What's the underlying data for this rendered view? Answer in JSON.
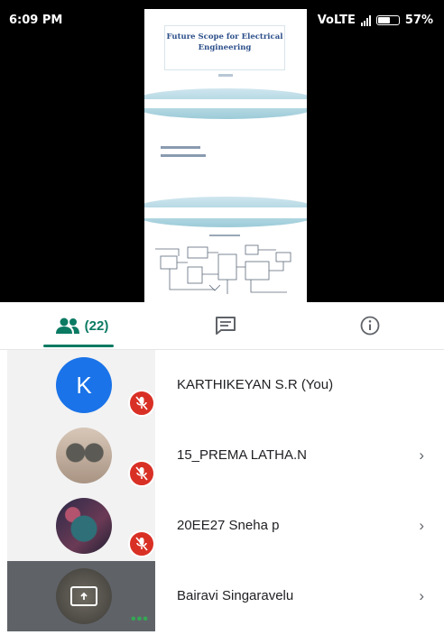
{
  "status_bar": {
    "time": "6:09 PM",
    "network": "VoLTE",
    "battery": "57%"
  },
  "presentation": {
    "slide1_title_line1": "Future Scope for Electrical",
    "slide1_title_line2": "Engineering"
  },
  "tabs": {
    "people_count": "(22)"
  },
  "participants": [
    {
      "name": "KARTHIKEYAN S.R (You)",
      "initial": "K",
      "muted": true
    },
    {
      "name": "15_PREMA LATHA.N",
      "muted": true
    },
    {
      "name": "20EE27 Sneha p",
      "muted": true
    },
    {
      "name": "Bairavi Singaravelu",
      "presenting": true
    }
  ],
  "colors": {
    "accent": "#0b7a63",
    "mute_badge": "#d93025",
    "avatar_blue": "#1a73e8"
  }
}
